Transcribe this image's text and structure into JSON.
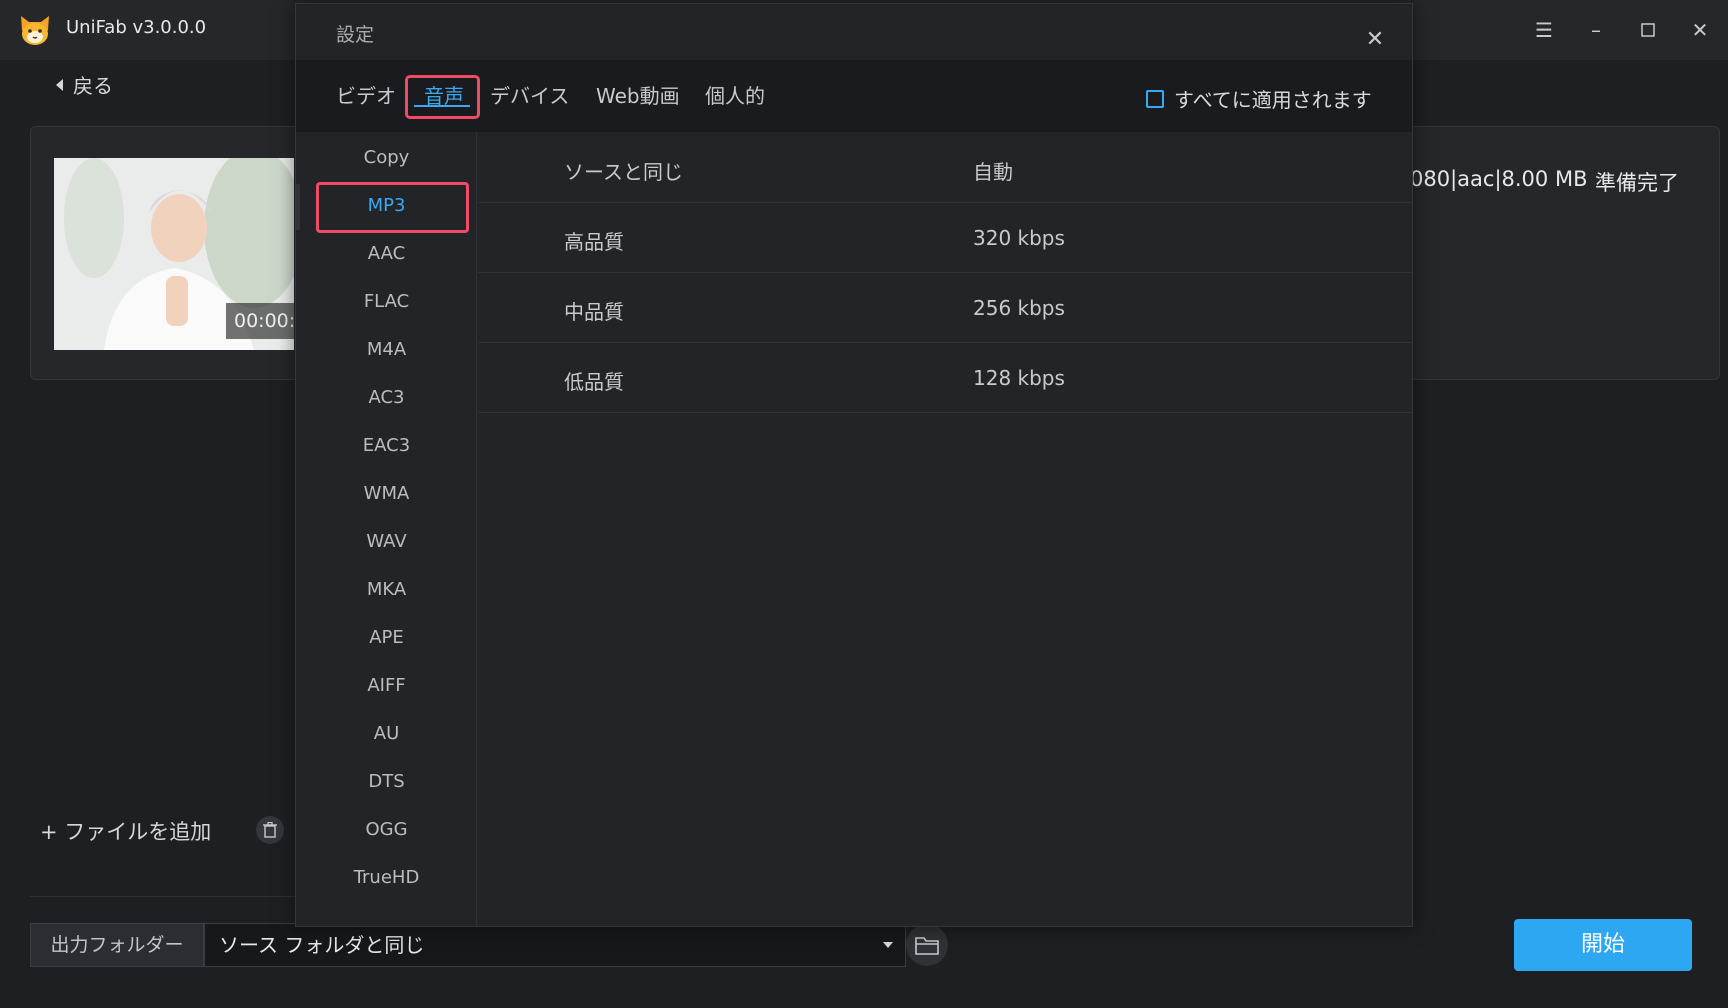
{
  "app": {
    "title": "UniFab v3.0.0.0"
  },
  "nav": {
    "back_label": "戻る"
  },
  "file": {
    "duration": "00:00:",
    "info": "080|aac|8.00 MB",
    "status": "準備完了"
  },
  "actions": {
    "add_file": "+ ファイルを追加"
  },
  "output": {
    "label": "出力フォルダー",
    "value": "ソース フォルダと同じ"
  },
  "start_button": "開始",
  "dialog": {
    "title": "設定",
    "tabs": [
      "ビデオ",
      "音声",
      "デバイス",
      "Web動画",
      "個人的"
    ],
    "selected_tab": "音声",
    "apply_all": "すべてに適用されます",
    "formats": [
      "Copy",
      "MP3",
      "AAC",
      "FLAC",
      "M4A",
      "AC3",
      "EAC3",
      "WMA",
      "WAV",
      "MKA",
      "APE",
      "AIFF",
      "AU",
      "DTS",
      "OGG",
      "TrueHD"
    ],
    "selected_format": "MP3",
    "qualities": [
      {
        "name": "ソースと同じ",
        "value": "自動"
      },
      {
        "name": "高品質",
        "value": "320 kbps"
      },
      {
        "name": "中品質",
        "value": "256 kbps"
      },
      {
        "name": "低品質",
        "value": "128 kbps"
      }
    ]
  },
  "colors": {
    "accent": "#2ea7f2",
    "highlight": "#ef4b64",
    "background": "#1d1f23"
  }
}
